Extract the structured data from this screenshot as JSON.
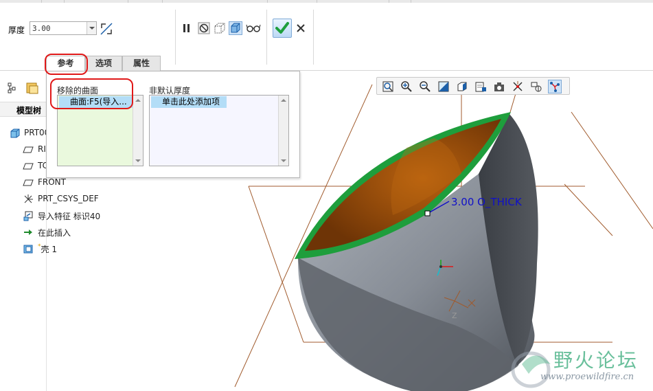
{
  "dashboard": {
    "thickness_label": "厚度",
    "thickness_value": "3.00"
  },
  "tabs": [
    {
      "label": "参考"
    },
    {
      "label": "选项"
    },
    {
      "label": "属性"
    }
  ],
  "model_tree": {
    "header": "模型树",
    "items": [
      {
        "label": "PRT00",
        "icon": "part-icon"
      },
      {
        "label": "RI",
        "icon": "datum-plane-icon"
      },
      {
        "label": "TC",
        "icon": "datum-plane-icon"
      },
      {
        "label": "FRONT",
        "icon": "datum-plane-icon"
      },
      {
        "label": "PRT_CSYS_DEF",
        "icon": "csys-icon"
      },
      {
        "label": "导入特征 标识40",
        "icon": "import-feature-icon"
      },
      {
        "label": "在此插入",
        "icon": "insert-here-arrow-icon"
      },
      {
        "label": "壳 1",
        "icon": "shell-feature-icon"
      }
    ]
  },
  "references": {
    "removed_surfaces_label": "移除的曲面",
    "removed_surfaces_item": "曲面:F5(导入...",
    "nondefault_thickness_label": "非默认厚度",
    "nondefault_thickness_item": "单击此处添加项"
  },
  "graphics": {
    "dimension_label": "3.00 O_THICK",
    "csys_axis_label": "Z"
  },
  "watermark": {
    "title": "野火论坛",
    "url": "www.proewildfire.cn"
  },
  "colors": {
    "accent_green": "#1e9e3c",
    "surface_orange": "#a3520a",
    "body_gray": "#8a9099",
    "datum_brown": "#a05a2c",
    "dimension_blue": "#1010c8",
    "annotation_red": "#e01818"
  }
}
